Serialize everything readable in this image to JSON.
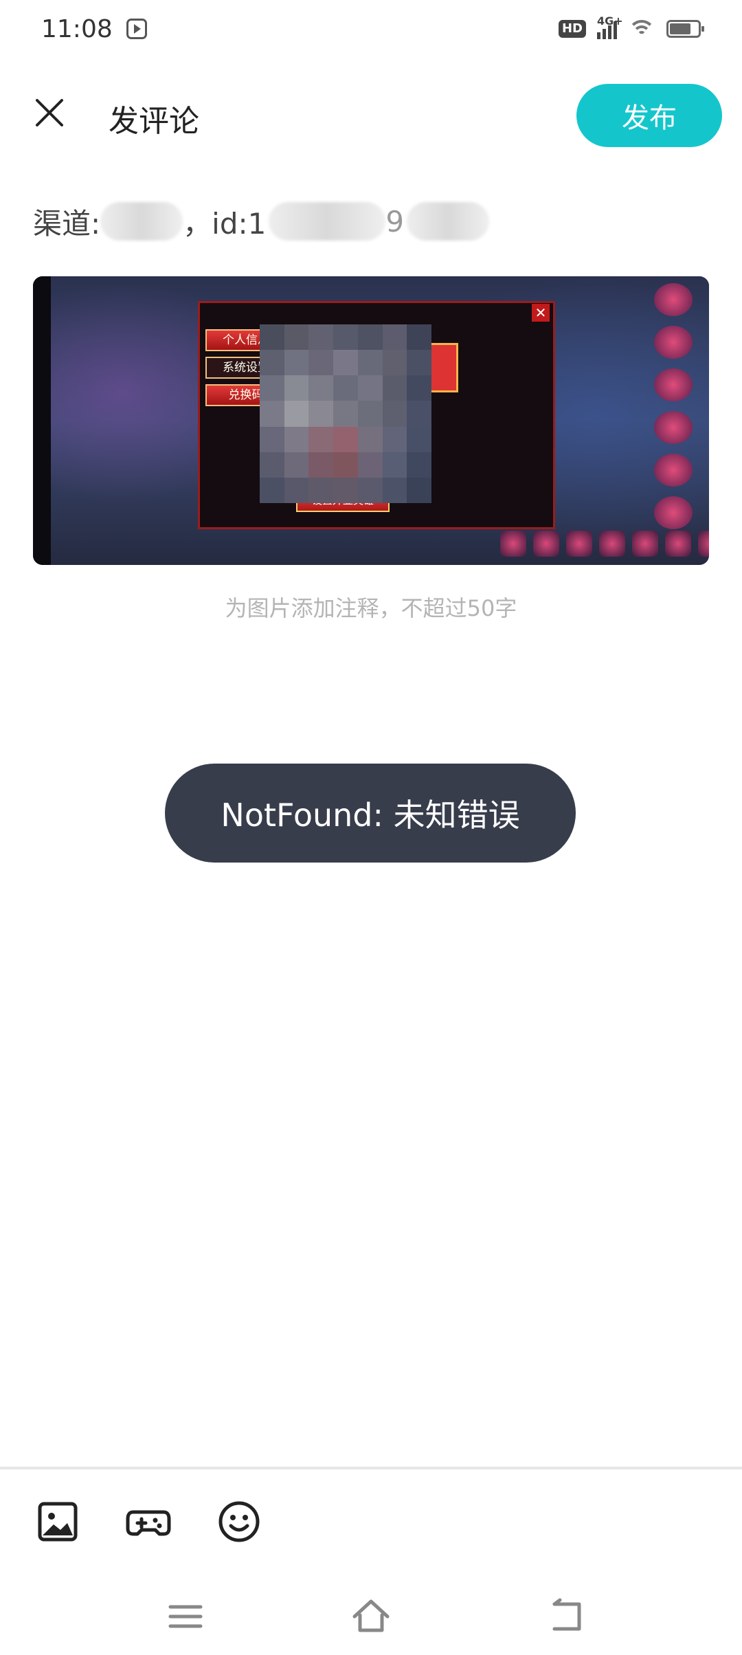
{
  "status_bar": {
    "time": "11:08",
    "hd_badge": "HD",
    "network": "4G+"
  },
  "header": {
    "title": "发评论",
    "publish_label": "发布"
  },
  "comment": {
    "channel_prefix": "渠道:",
    "id_separator": "，id:1",
    "id_visible_digit": "9"
  },
  "attachment": {
    "game_menu_items": [
      "个人信息",
      "系统设置",
      "兑换码"
    ],
    "game_action_button": "设置外显英雄",
    "caption_placeholder": "为图片添加注释，不超过50字"
  },
  "toast": {
    "message": "NotFound: 未知错误"
  },
  "toolbar": {
    "icons": [
      "image-icon",
      "gamepad-icon",
      "emoji-icon"
    ]
  },
  "navigation": {
    "icons": [
      "menu-icon",
      "home-icon",
      "back-icon"
    ]
  },
  "colors": {
    "accent": "#14c6cc",
    "toast_bg": "#383d4c",
    "hint_text": "#b4b4b4"
  }
}
